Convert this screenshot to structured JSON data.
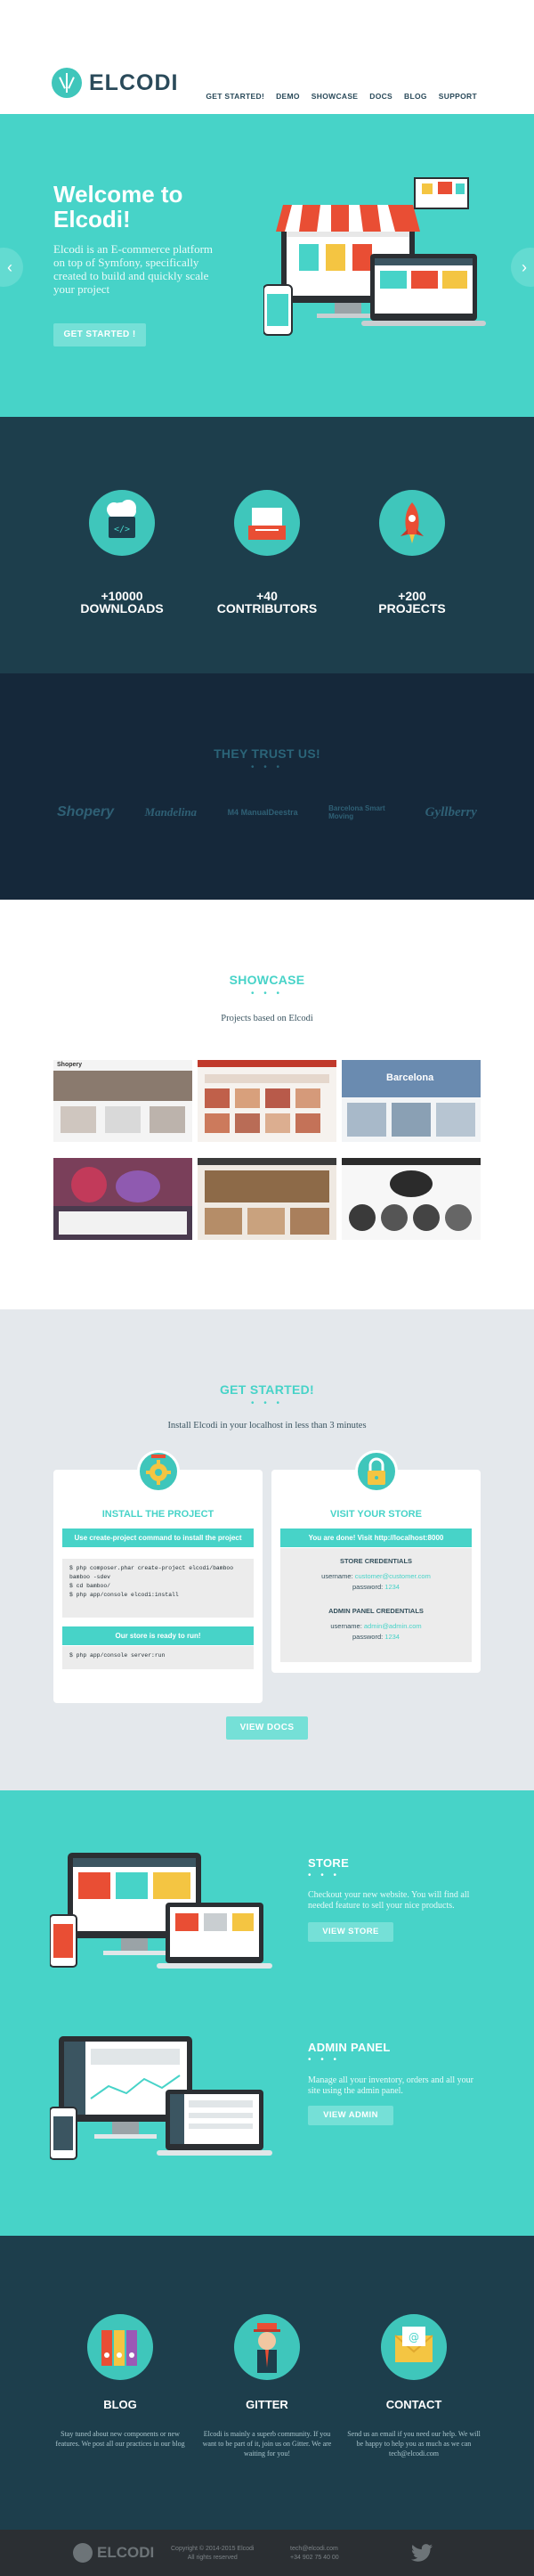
{
  "header": {
    "logo_text": "ELCODI",
    "nav": [
      "GET STARTED!",
      "DEMO",
      "SHOWCASE",
      "DOCS",
      "BLOG",
      "SUPPORT"
    ]
  },
  "hero": {
    "title": "Welcome to Elcodi!",
    "text": "Elcodi is an E-commerce platform on top of Symfony, specifically created to build and quickly scale your project",
    "button": "GET STARTED !",
    "left_arrow": "‹",
    "right_arrow": "›"
  },
  "stats": [
    {
      "number": "+10000",
      "label": "DOWNLOADS",
      "icon": "cloud-code-icon"
    },
    {
      "number": "+40",
      "label": "CONTRIBUTORS",
      "icon": "book-icon"
    },
    {
      "number": "+200",
      "label": "PROJECTS",
      "icon": "rocket-icon"
    }
  ],
  "trust": {
    "title": "THEY TRUST US!",
    "dots": "• • •",
    "brands": [
      "Shopery",
      "Mandelina",
      "M4 ManualDeestra",
      "Barcelona Smart Moving",
      "Gyllberry"
    ]
  },
  "showcase": {
    "title": "SHOWCASE",
    "dots": "• • •",
    "subtitle": "Projects based on Elcodi",
    "thumb_labels": [
      "Shopery",
      "",
      "Barcelona",
      "",
      "",
      ""
    ]
  },
  "get_started": {
    "title": "GET STARTED!",
    "dots": "• • •",
    "subtitle": "Install Elcodi in your localhost in less than 3 minutes",
    "install": {
      "title": "INSTALL THE PROJECT",
      "step1": "Use create-project command to install the project",
      "code1": "$ php composer.phar create-project elcodi/bamboo bamboo -sdev\n$ cd bamboo/\n$ php app/console elcodi:install",
      "step2": "Our store is ready to run!",
      "code2": "$ php app/console server:run"
    },
    "visit": {
      "title": "VISIT YOUR STORE",
      "bar": "You are done! Visit http://localhost:8000",
      "store_heading": "STORE CREDENTIALS",
      "store_user_label": "username:",
      "store_user": "customer@customer.com",
      "store_pass_label": "password:",
      "store_pass": "1234",
      "admin_heading": "ADMIN PANEL CREDENTIALS",
      "admin_user_label": "username:",
      "admin_user": "admin@admin.com",
      "admin_pass_label": "password:",
      "admin_pass": "1234"
    },
    "button": "VIEW DOCS"
  },
  "features": [
    {
      "title": "STORE",
      "dots": "• • •",
      "text": "Checkout your new website. You will find all needed feature to sell your nice products.",
      "button": "VIEW STORE"
    },
    {
      "title": "ADMIN PANEL",
      "dots": "• • •",
      "text": "Manage all your inventory, orders and all your site using the admin panel.",
      "button": "VIEW ADMIN"
    }
  ],
  "contact": [
    {
      "title": "BLOG",
      "text": "Stay tuned about new components or new features. We post all our practices in our blog",
      "icon": "binders-icon"
    },
    {
      "title": "GITTER",
      "text": "Elcodi is mainly a superb community. If you want to be part of it, join us on Gitter. We are waiting for you!",
      "icon": "person-icon"
    },
    {
      "title": "CONTACT",
      "text": "Send us an email if you need our help. We will be happy to help you as much as we can tech@elcodi.com",
      "icon": "envelope-icon"
    }
  ],
  "footer": {
    "logo_text": "ELCODI",
    "copyright": "Copyright © 2014-2015 Elcodi",
    "rights": "All rights reserved",
    "email": "tech@elcodi.com",
    "phone": "+34 902 75 40 00"
  },
  "colors": {
    "turquoise": "#47d3c8",
    "navy": "#1d3e4c",
    "dark_navy": "#15283a",
    "light_gray": "#e4e8ec"
  }
}
